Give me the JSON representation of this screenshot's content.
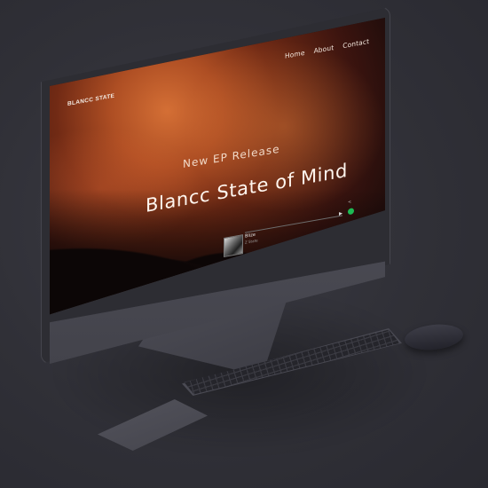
{
  "website": {
    "logo": "BLANCC STATE",
    "nav": [
      "Home",
      "About",
      "Contact"
    ],
    "hero": {
      "subtitle": "New EP Release",
      "title": "Blancc State of Mind"
    },
    "player": {
      "track": "Blize",
      "artist": "Z State",
      "progress": 0.0,
      "spotify_color": "#1db954"
    }
  },
  "devices": {
    "icons": [
      "play-icon",
      "spotify-icon",
      "share-icon"
    ]
  }
}
